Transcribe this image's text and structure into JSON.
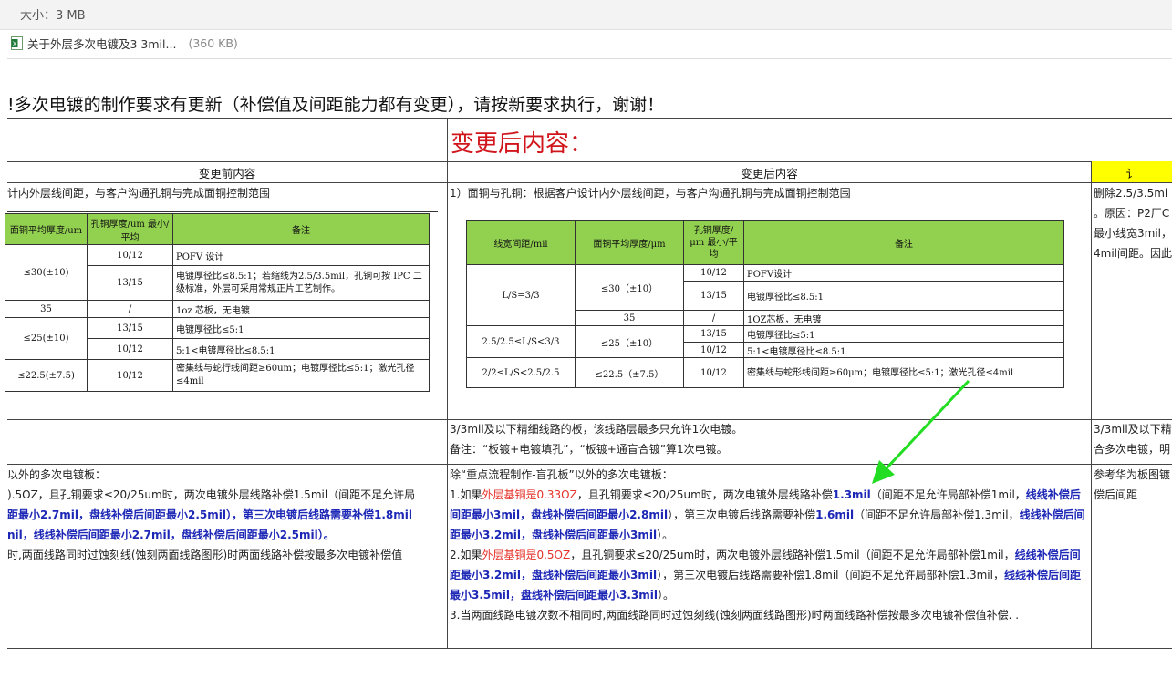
{
  "header": {
    "size_line": "大小：3 MB",
    "attachment": {
      "name": "关于外层多次电镀及3 3mil...",
      "size": "(360 KB)",
      "icon": "excel-file-icon"
    }
  },
  "notice": "!多次电镀的制作要求有更新（补偿值及间距能力都有变更），请按新要求执行，谢谢！",
  "big_title": "变更后内容：",
  "columns": {
    "before": "变更前内容",
    "after": "变更后内容",
    "third": "讠"
  },
  "row1": {
    "left": "计内外层线间距，与客户沟通孔铜与完成面铜控制范围",
    "mid": "1）面铜与孔铜：根据客户设计内外层线间距，与客户沟通孔铜与完成面铜控制范围",
    "right": [
      "删除2.5/3.5mi",
      "。原因：P2厂C",
      "最小线宽3mil，",
      "4mil间距。因此"
    ]
  },
  "old_table": {
    "headers": [
      "面铜平均厚度/um",
      "孔铜厚度/um 最小/平均",
      "备注"
    ],
    "rows": [
      [
        "≤30(±10)",
        "10/12",
        "POFV 设计"
      ],
      [
        "",
        "13/15",
        "电镀厚径比≤8.5:1；若缩线为2.5/3.5mil，孔铜可按 IPC 二级标准，外层可采用常规正片工艺制作。"
      ],
      [
        "35",
        "/",
        "1oz 芯板，无电镀"
      ],
      [
        "≤25(±10)",
        "13/15",
        "电镀厚径比≤5:1"
      ],
      [
        "",
        "10/12",
        "5:1<电镀厚径比≤8.5:1"
      ],
      [
        "≤22.5(±7.5)",
        "10/12",
        "密集线与蛇行线间距≥60um；电镀厚径比≤5:1；激光孔径≤4mil"
      ]
    ]
  },
  "new_table": {
    "headers": [
      "线宽间距/mil",
      "面铜平均厚度/μm",
      "孔铜厚度/μm 最小/平均",
      "备注"
    ],
    "r1_ls": "L/S=3/3",
    "r1_cu": "≤30（±10）",
    "r1a": [
      "10/12",
      "POFV设计"
    ],
    "r1b": [
      "13/15",
      "电镀厚径比≤8.5:1"
    ],
    "r1c": [
      "35",
      "/",
      "1OZ芯板，无电镀"
    ],
    "r2_ls": "2.5/2.5≤L/S<3/3",
    "r2_cu": "≤25（±10）",
    "r2a": [
      "13/15",
      "电镀厚径比≤5:1"
    ],
    "r2b": [
      "10/12",
      "5:1<电镀厚径比≤8.5:1"
    ],
    "r3": [
      "2/2≤L/S<2.5/2.5",
      "≤22.5（±7.5）",
      "10/12",
      "密集线与蛇形线间距≥60μm；电镀厚径比≤5:1；激光孔径≤4mil"
    ]
  },
  "row2": {
    "mid": [
      "3/3mil及以下精细线路的板，该线路层最多只允许1次电镀。",
      "备注：“板镀+电镀填孔”，“板镀+通盲合镀”算1次电镀。"
    ],
    "right": [
      "3/3mil及以下精",
      "合多次电镀，明"
    ]
  },
  "row3": {
    "left": [
      "以外的多次电镀板：",
      ").5OZ，且孔铜要求≤20/25um时，两次电镀外层线路补偿1.5mil（间距不足允许局",
      "距最小2.7mil，盘线补偿后间距最小2.5mil），第三次电镀后线路需要补偿1.8mil",
      "nil，线线补偿后间距最小2.7mil，盘线补偿后间距最小2.5mil）。",
      "时,两面线路同时过蚀刻线(蚀刻两面线路图形)时两面线路补偿按最多次电镀补偿值"
    ],
    "mid_title": "除“重点流程制作-盲孔板”以外的多次电镀板：",
    "p1": {
      "a": "1.如果",
      "red": "外层基铜是0.33OZ",
      "b": "，且孔铜要求≤20/25um时，两次电镀外层线路补偿",
      "blue1": "1.3mil",
      "c": "（间距不足允许局部补偿1mil，",
      "blue2": "线线",
      "blue3": "补偿后间距最小3mil，盘线补偿后间距最小2.8mil",
      "d": "），第三次电镀后线路需要补偿",
      "blue4": "1.6mil",
      "e": "（间距不足允许局部补偿",
      "f": "1.3mil，",
      "blue5": "线线补偿后间距最小3.2mil，盘线补偿后间距最小3mil",
      "g": "）。"
    },
    "p2": {
      "a": "2.如果",
      "red": "外层基铜是0.5OZ",
      "b": "，且孔铜要求≤20/25um时，两次电镀外层线路补偿1.5mil（间距不足允许局部补偿1mil，",
      "blue1": "线线补",
      "blue2": "偿后间距最小3.2mil，盘线补偿后间距最小3mil",
      "c": "），第三次电镀后线路需要补偿1.8mil（间距不足允许局部补偿1.3mil，",
      "blue3": "线线补偿后间距最小3.5mil，盘线补偿后间距最小3.3mil",
      "d": "）。"
    },
    "p3": "3.当两面线路电镀次数不相同时,两面线路同时过蚀刻线(蚀刻两面线路图形)时两面线路补偿按最多次电镀补偿值补偿. .",
    "right": [
      "参考华为板图镀",
      "偿后间距"
    ]
  },
  "colors": {
    "title_red": "#d0161c",
    "text_red": "#e5322b",
    "text_blue": "#1d27b6",
    "table_green": "#92d050",
    "highlight": "#ffff00",
    "arrow": "#22dd22"
  }
}
